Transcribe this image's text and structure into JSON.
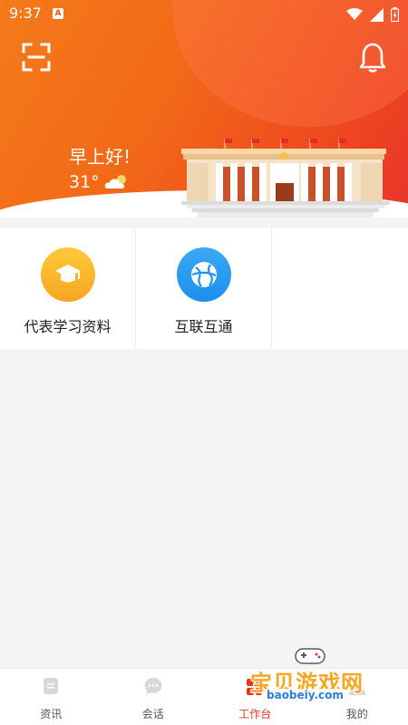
{
  "statusbar": {
    "time": "9:37",
    "indicator": "A"
  },
  "header": {
    "greeting": "早上好!",
    "temperature": "31°",
    "weather_icon": "cloud-sun-icon",
    "accent": "#f26a18"
  },
  "tiles": [
    {
      "label": "代表学习资料",
      "icon": "graduation-cap-icon",
      "color": "#f6b32b"
    },
    {
      "label": "互联互通",
      "icon": "globe-network-icon",
      "color": "#1e93f0"
    }
  ],
  "bottom_nav": {
    "items": [
      {
        "label": "资讯",
        "icon": "news-icon"
      },
      {
        "label": "会话",
        "icon": "chat-icon"
      },
      {
        "label": "工作台",
        "icon": "workbench-icon",
        "active": true
      },
      {
        "label": "我的",
        "icon": "profile-icon"
      }
    ],
    "active_color": "#e8351e"
  },
  "watermark": {
    "text": "宝贝游戏网",
    "url": "baobeiy.com"
  }
}
